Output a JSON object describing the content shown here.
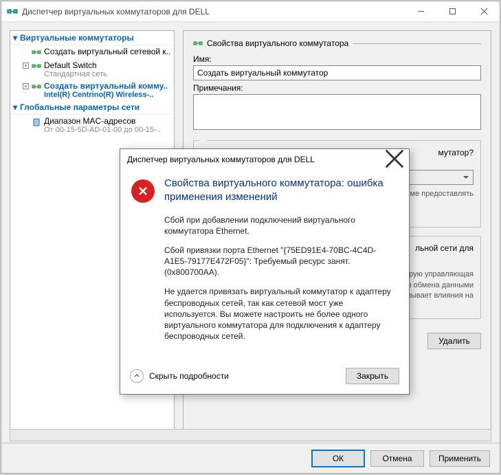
{
  "window": {
    "title": "Диспетчер виртуальных коммутаторов для DELL"
  },
  "tree": {
    "section1_title": "Виртуальные коммутаторы",
    "item_create": "Создать виртуальный сетевой к..",
    "default_switch": "Default Switch",
    "default_switch_sub": "Стандартная сеть",
    "create_vsw": "Создать виртуальный комму..",
    "create_vsw_sub": "Intel(R) Centrino(R) Wireless-..",
    "section2_title": "Глобальные параметры сети",
    "mac_range": "Диапазон MAC-адресов",
    "mac_range_sub": "От 00-15-5D-AD-01-00 до 00-15-.."
  },
  "props": {
    "group_title": "Свойства виртуального коммутатора",
    "name_label": "Имя:",
    "name_value": "Создать виртуальный коммутатор",
    "notes_label": "Примечания:",
    "conn_question": "мутатор?",
    "share_text": "теме предоставлять",
    "vlan_title": "льной сети для",
    "vlan_text_a": "торую управляющая",
    "vlan_text_b": "для обмена данными",
    "vlan_text_c": "оказывает влияния на",
    "delete_label": "Удалить"
  },
  "buttons": {
    "ok": "ОК",
    "cancel": "Отмена",
    "apply": "Применить"
  },
  "modal": {
    "title": "Диспетчер виртуальных коммутаторов для DELL",
    "heading": "Свойства виртуального коммутатора: ошибка применения изменений",
    "p1": "Сбой при добавлении подключений виртуального коммутатора Ethernet.",
    "p2": "Сбой привязки порта Ethernet \"{75ED91E4-70BC-4C4D-A1E5-79177E472F05}\": Требуемый ресурс занят. (0x800700AA).",
    "p3": "Не удается привязать виртуальный коммутатор к адаптеру беспроводных сетей, так как сетевой мост уже используется. Вы можете настроить не более одного виртуального коммутатора для подключения к адаптеру беспроводных сетей.",
    "hide_details": "Скрыть подробности",
    "close": "Закрыть"
  }
}
